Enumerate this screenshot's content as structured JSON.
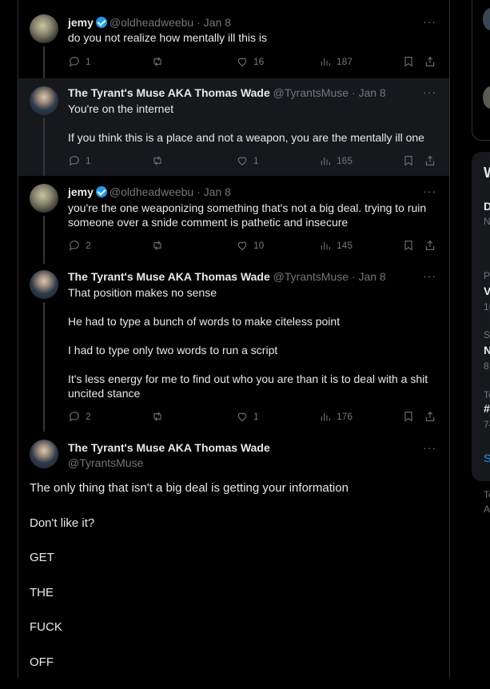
{
  "thread": [
    {
      "display_name": "jemy",
      "handle": "@oldheadweebu",
      "date": "· Jan 8",
      "paragraphs": [
        "do you not realize how mentally ill this is"
      ],
      "replies": "1",
      "reposts": "",
      "likes": "16",
      "views": "187"
    },
    {
      "display_name": "The Tyrant's Muse AKA Thomas Wade",
      "handle": "@TyrantsMuse",
      "date": "· Jan 8",
      "paragraphs": [
        "You're on the internet",
        "If you think this is a place and not a weapon, you are the mentally ill one"
      ],
      "replies": "1",
      "reposts": "",
      "likes": "1",
      "views": "165"
    },
    {
      "display_name": "jemy",
      "handle": "@oldheadweebu",
      "date": "· Jan 8",
      "paragraphs": [
        "you're the one weaponizing something that's not a big deal. trying to ruin someone over a snide comment is pathetic and insecure"
      ],
      "replies": "2",
      "reposts": "",
      "likes": "10",
      "views": "145"
    },
    {
      "display_name": "The Tyrant's Muse AKA Thomas Wade",
      "handle": "@TyrantsMuse",
      "date": "· Jan 8",
      "paragraphs": [
        "That position makes no sense",
        "He had to type a bunch of words to make citeless point",
        "I had to type only two words to run a script",
        "It's less energy for me to find out who you are than it is to deal with a shit uncited stance"
      ],
      "replies": "2",
      "reposts": "",
      "likes": "1",
      "views": "176"
    }
  ],
  "main_tweet": {
    "display_name": "The Tyrant's Muse AKA Thomas Wade",
    "handle": "@TyrantsMuse",
    "paragraphs": [
      "The only thing that isn't a big deal is getting your information",
      "Don't like it?",
      "GET",
      "THE",
      "FUCK",
      "OFF"
    ]
  },
  "more_label": "···",
  "right_sidebar": {
    "fragments": [
      "W",
      "D",
      "N",
      "P",
      "V",
      "16",
      "S",
      "N",
      "8",
      "Te",
      "#",
      "74",
      "S",
      "Te",
      "Ac"
    ]
  },
  "colors": {
    "accent": "#1d9bf0",
    "muted": "#71767b",
    "border": "#2f3336",
    "highlight": "#16181c"
  }
}
